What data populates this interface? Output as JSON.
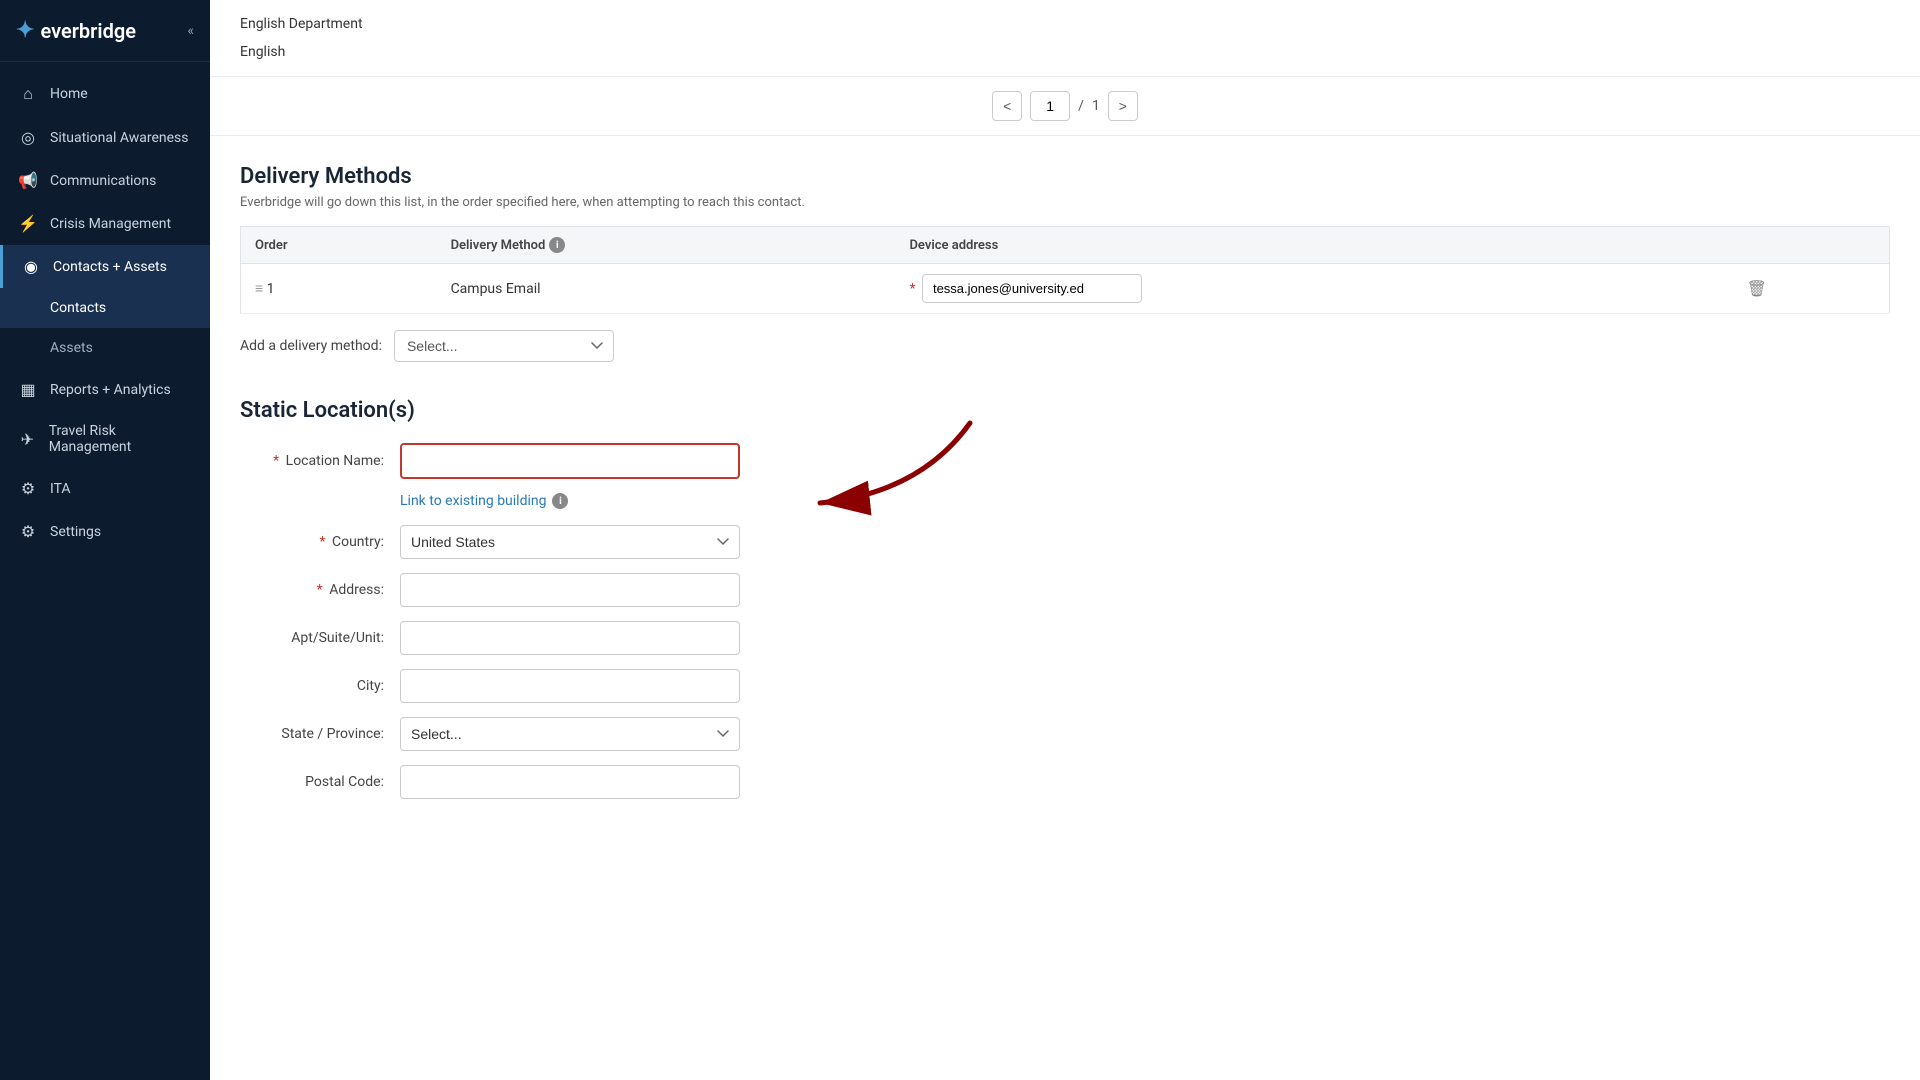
{
  "sidebar": {
    "logo": "everbridge",
    "logo_icon": "✦",
    "collapse_icon": "«",
    "items": [
      {
        "id": "home",
        "label": "Home",
        "icon": "⌂",
        "active": false
      },
      {
        "id": "situational-awareness",
        "label": "Situational Awareness",
        "icon": "◎",
        "active": false
      },
      {
        "id": "communications",
        "label": "Communications",
        "icon": "📢",
        "active": false
      },
      {
        "id": "crisis-management",
        "label": "Crisis Management",
        "icon": "⚡",
        "active": false
      },
      {
        "id": "contacts-assets",
        "label": "Contacts + Assets",
        "icon": "◉",
        "active": true
      },
      {
        "id": "contacts-sub",
        "label": "Contacts",
        "icon": "",
        "active": true,
        "sub": true
      },
      {
        "id": "assets-sub",
        "label": "Assets",
        "icon": "",
        "active": false,
        "sub": true
      },
      {
        "id": "reports-analytics",
        "label": "Reports + Analytics",
        "icon": "▦",
        "active": false
      },
      {
        "id": "travel-risk",
        "label": "Travel Risk Management",
        "icon": "✈",
        "active": false
      },
      {
        "id": "ita",
        "label": "ITA",
        "icon": "⚙",
        "active": false
      },
      {
        "id": "settings",
        "label": "Settings",
        "icon": "⚙",
        "active": false
      }
    ]
  },
  "top_items": [
    {
      "text": "English Department"
    },
    {
      "text": "English"
    }
  ],
  "pagination": {
    "current_page": "1",
    "total_pages": "1",
    "prev_icon": "<",
    "next_icon": ">"
  },
  "delivery_methods": {
    "section_title": "Delivery Methods",
    "section_desc": "Everbridge will go down this list, in the order specified here, when attempting to reach this contact.",
    "table_headers": {
      "order": "Order",
      "delivery_method": "Delivery Method",
      "device_address": "Device address"
    },
    "rows": [
      {
        "order": "1",
        "method": "Campus Email",
        "device_value": "tessa.jones@university.ed",
        "required": true
      }
    ],
    "add_label": "Add a delivery method:",
    "add_placeholder": "Select..."
  },
  "static_locations": {
    "section_title": "Static Location(s)",
    "location_name_label": "Location Name:",
    "location_name_placeholder": "",
    "link_text": "Link to existing building",
    "country_label": "Country:",
    "country_value": "United States",
    "address_label": "Address:",
    "address_placeholder": "",
    "apt_label": "Apt/Suite/Unit:",
    "apt_placeholder": "",
    "city_label": "City:",
    "city_placeholder": "",
    "state_label": "State / Province:",
    "state_placeholder": "Select...",
    "postal_label": "Postal Code:",
    "postal_placeholder": ""
  },
  "icons": {
    "info": "i",
    "drag": "≡",
    "delete": "🗑",
    "chevron_down": "▾"
  }
}
